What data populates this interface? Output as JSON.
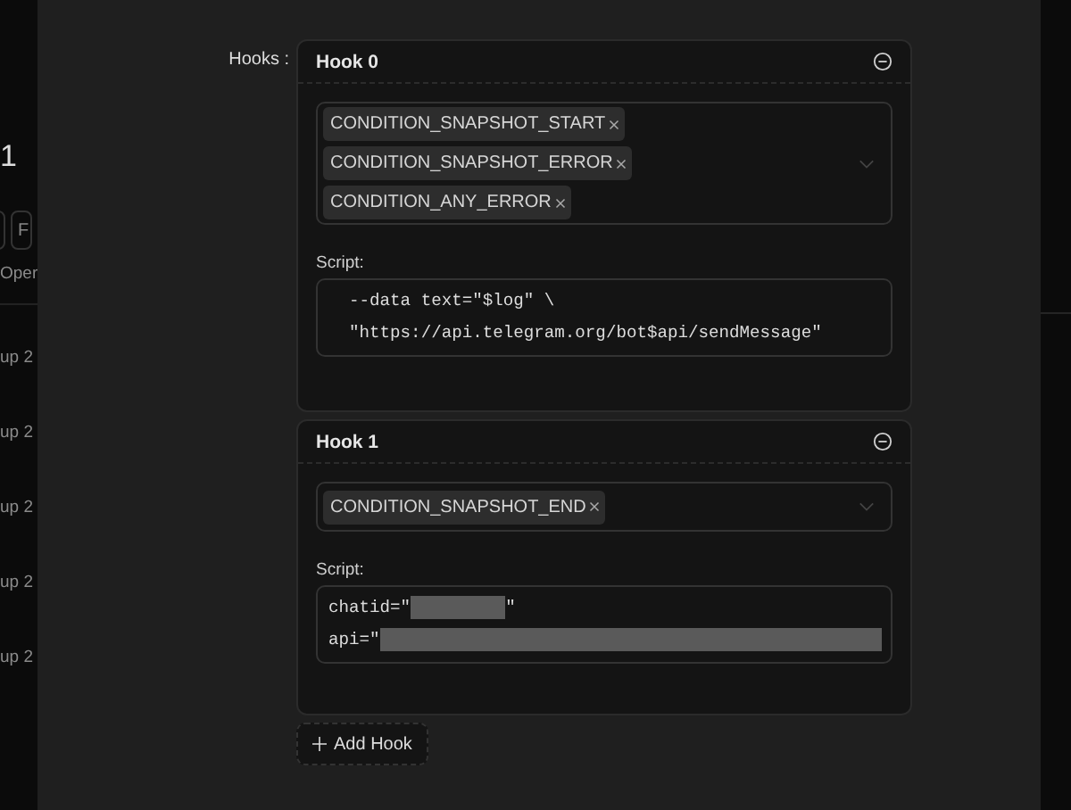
{
  "background_page": {
    "heading": "1",
    "buttons": [
      "F"
    ],
    "column_header": "Oper",
    "rows": [
      "up 2",
      "up 2",
      "up 2",
      "up 2",
      "up 2"
    ]
  },
  "form": {
    "label": "Hooks :",
    "hooks": [
      {
        "title": "Hook 0",
        "conditions": [
          "CONDITION_SNAPSHOT_START",
          "CONDITION_SNAPSHOT_ERROR",
          "CONDITION_ANY_ERROR"
        ],
        "script_label": "Script:",
        "script_lines": [
          [
            {
              "kind": "text",
              "text": "  --data text=\"$log\" \\"
            }
          ],
          [
            {
              "kind": "text",
              "text": "  \"https://api.telegram.org/bot$api/sendMessage\""
            }
          ]
        ]
      },
      {
        "title": "Hook 1",
        "conditions": [
          "CONDITION_SNAPSHOT_END"
        ],
        "script_label": "Script:",
        "script_lines": [
          [
            {
              "kind": "text",
              "text": "chatid=\""
            },
            {
              "kind": "redacted_short"
            },
            {
              "kind": "text",
              "text": "\""
            }
          ],
          [
            {
              "kind": "text",
              "text": "api=\""
            },
            {
              "kind": "redacted_fill"
            }
          ]
        ]
      }
    ],
    "add_button": "Add Hook"
  }
}
